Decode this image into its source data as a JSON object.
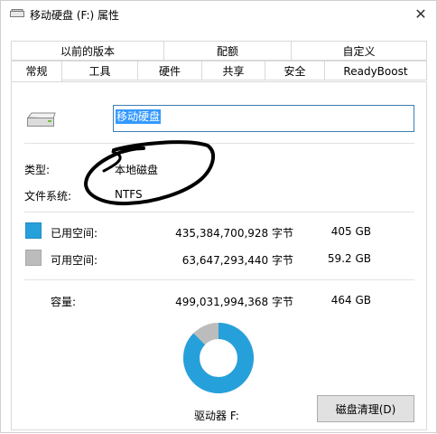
{
  "window": {
    "title": "移动硬盘 (F:) 属性",
    "close": "✕"
  },
  "tabs_top": [
    "以前的版本",
    "配额",
    "自定义"
  ],
  "tabs_bottom": [
    "常规",
    "工具",
    "硬件",
    "共享",
    "安全",
    "ReadyBoost"
  ],
  "active_tab": "常规",
  "general": {
    "drive_name": "移动硬盘",
    "type_label": "类型:",
    "type_value": "本地磁盘",
    "fs_label": "文件系统:",
    "fs_value": "NTFS",
    "used_label": "已用空间:",
    "used_bytes": "435,384,700,928 字节",
    "used_size": "405 GB",
    "free_label": "可用空间:",
    "free_bytes": "63,647,293,440 字节",
    "free_size": "59.2 GB",
    "capacity_label": "容量:",
    "capacity_bytes": "499,031,994,368 字节",
    "capacity_size": "464 GB",
    "drive_letter": "驱动器 F:",
    "cleanup_button": "磁盘清理(D)"
  },
  "colors": {
    "used": "#26a0da",
    "free": "#bcbcbc"
  },
  "usage": {
    "used_fraction": 0.8725
  }
}
